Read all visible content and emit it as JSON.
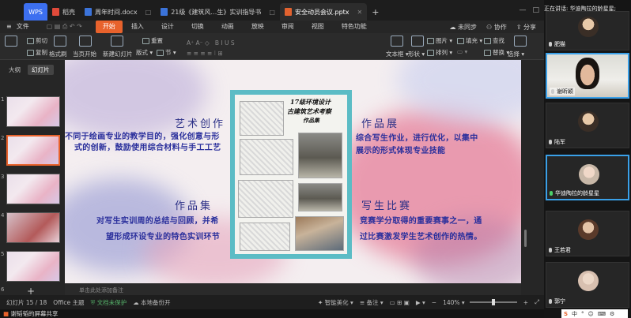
{
  "titlebar": {
    "tabs": [
      {
        "label": "WPS",
        "kind": "wps"
      },
      {
        "label": "稻壳",
        "kind": "docer"
      },
      {
        "label": "周年时间.docx",
        "kind": "word"
      },
      {
        "label": "21级《建筑风…生》实训指导书",
        "kind": "word"
      },
      {
        "label": "安全动员会议.pptx",
        "kind": "ppt"
      }
    ],
    "add_tab": "+"
  },
  "menubar": {
    "file": "文件",
    "items": [
      "开始",
      "插入",
      "设计",
      "切换",
      "动画",
      "放映",
      "审阅",
      "视图",
      "特色功能"
    ],
    "right": [
      "未同步",
      "协作",
      "分享"
    ]
  },
  "ribbon": {
    "cut": "剪切",
    "copy": "复制",
    "format_painter": "格式刷",
    "from_current": "当页开始",
    "new_slide": "新建幻灯片",
    "layout": "版式",
    "section": "节",
    "reset": "重置",
    "textbox": "文本框",
    "shape": "形状",
    "arrange": "排列",
    "picture": "图片",
    "fill": "填充",
    "find": "查找",
    "replace": "替换",
    "select": "选择"
  },
  "leftpanel": {
    "tabs": [
      "大纲",
      "幻灯片"
    ],
    "thumb_numbers": [
      "1",
      "2",
      "3",
      "4",
      "5",
      "6"
    ],
    "add": "+"
  },
  "slide": {
    "heading_tl": "艺术创作",
    "body_tl": [
      "不同于绘画专业的教学目的，强化创意与形",
      "式的创新，鼓励使用综合材料与手工工艺"
    ],
    "heading_tr": "作品展",
    "body_tr": [
      "综合写生作业，进行优化，以集中",
      "展示的形式体现专业技能"
    ],
    "heading_bl": "作品集",
    "body_bl": [
      "对写生实训周的总结与回顾，并希",
      "望形成环设专业的特色实训环节"
    ],
    "heading_br": "写生比赛",
    "body_br": [
      "竞赛学分取得的重要赛事之一，通",
      "过比赛激发学生艺术创作的热情。"
    ],
    "poster_lines": [
      "17级环境设计",
      "古建筑艺术考察",
      "作品集"
    ]
  },
  "notes_placeholder": "单击此处添加备注",
  "statusbar": {
    "slide_info": "幻灯片 15 / 18",
    "theme": "Office 主题",
    "protect": "文档未保护",
    "backup": "本地备份开",
    "beautify": "智能美化",
    "notes": "备注",
    "zoom": "140%"
  },
  "bottombar": {
    "sharing": "谢韬韬的屏幕共享"
  },
  "meeting": {
    "speaking": "正在讲话: 华迪陶拉的龄星星;",
    "participants": [
      "肥猫",
      "谢昕颖",
      "陆军",
      "华迪陶拉的龄星星",
      "王若君",
      "郭宁"
    ]
  },
  "ime": {
    "logo": "S",
    "items": [
      "中",
      "°",
      "☺",
      "⌨",
      "⚙"
    ]
  }
}
